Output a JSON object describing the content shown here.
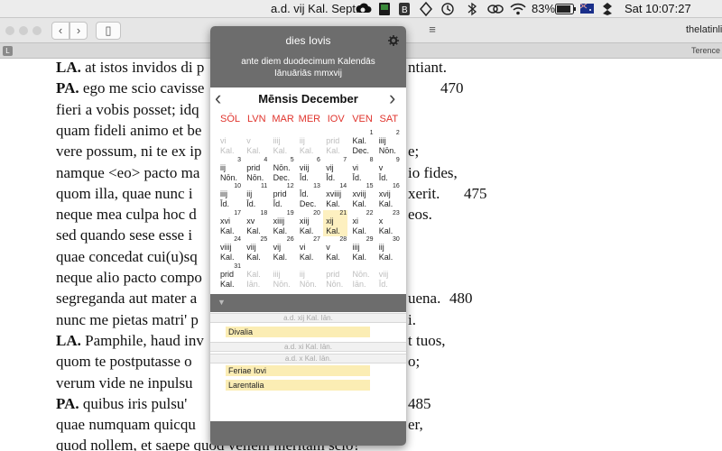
{
  "menubar": {
    "date": "a.d. vij Kal. Sept.",
    "battery": "83%",
    "time": "Sat 10:07:27",
    "icons": [
      "creative-cloud-icon",
      "display-icon",
      "backup-icon",
      "script-icon",
      "time-machine-icon",
      "bluetooth-icon",
      "link-icon",
      "wifi-icon",
      "flag-icon",
      "battery-icon",
      "dropbox-icon"
    ]
  },
  "toolbar": {
    "back": "‹",
    "forward": "›",
    "sidebar": "▯",
    "reader": "≡",
    "site": "thelatinli"
  },
  "tabbar": {
    "badge": "L",
    "right": "Terence"
  },
  "text": {
    "lines": [
      {
        "s": "LA.",
        "t": " at istos invidos di p",
        "e": "ntiant."
      },
      {
        "s": "PA.",
        "t": " ego me scio cavisse",
        "e": "",
        "no": "470"
      },
      {
        "s": "",
        "t": "fieri a vobis posset; idq",
        "e": ""
      },
      {
        "s": "",
        "t": "quam fideli animo et be",
        "e": ""
      },
      {
        "s": "",
        "t": "vere possum, ni te ex ip",
        "e": "e;"
      },
      {
        "s": "",
        "t": "namque <eo> pacto ma",
        "e": "io fides,"
      },
      {
        "s": "",
        "t": "quom illa, quae nunc i",
        "e": "xerit.",
        "no": "475"
      },
      {
        "s": "",
        "t": "neque mea culpa hoc d",
        "e": "eos."
      },
      {
        "s": "",
        "t": "sed quando sese esse i",
        "e": ""
      },
      {
        "s": "",
        "t": "quae concedat cui(u)sq",
        "e": ""
      },
      {
        "s": "",
        "t": "neque alio pacto compo",
        "e": ""
      },
      {
        "s": "",
        "t": "segreganda aut mater a",
        "e": "uena.",
        "no": "480"
      },
      {
        "s": "",
        "t": "nunc me pietas matri' p",
        "e": "i."
      },
      {
        "s": "LA.",
        "t": " Pamphile, haud inv",
        "e": "t tuos,"
      },
      {
        "s": "",
        "t": "quom te postputasse o",
        "e": "o;"
      },
      {
        "s": "",
        "t": "verum vide ne inpulsu",
        "e": ""
      },
      {
        "s": "PA.",
        "t": " quibus iris pulsu' ",
        "e": "",
        "no": "485"
      },
      {
        "s": "",
        "t": "quae numquam quicqu",
        "e": "er,"
      },
      {
        "s": "",
        "t": "quod nollem, et saepe quod vellem meritam scio?",
        "e": ""
      }
    ]
  },
  "popup": {
    "title": "dies Iovis",
    "subtitle1": "ante diem duodecimum Kalendās",
    "subtitle2": "Iānuāriās mmxvij",
    "month": "Mēnsis December",
    "prev": "‹",
    "next": "›",
    "dow": [
      "SŌL",
      "LVN",
      "MAR",
      "MER",
      "IOV",
      "VEN",
      "SAT"
    ],
    "weeks": [
      [
        {
          "a": "vi",
          "b": "Kal.",
          "n": "",
          "o": true
        },
        {
          "a": "v",
          "b": "Kal.",
          "n": "",
          "o": true
        },
        {
          "a": "iiij",
          "b": "Kal.",
          "n": "",
          "o": true
        },
        {
          "a": "iij",
          "b": "Kal.",
          "n": "",
          "o": true
        },
        {
          "a": "prid",
          "b": "Kal.",
          "n": "",
          "o": true
        },
        {
          "a": "Kal.",
          "b": "Dec.",
          "n": "1"
        },
        {
          "a": "iiij",
          "b": "Nōn.",
          "n": "2"
        }
      ],
      [
        {
          "a": "iij",
          "b": "Nōn.",
          "n": "3"
        },
        {
          "a": "prid",
          "b": "Nōn.",
          "n": "4"
        },
        {
          "a": "Nōn.",
          "b": "Dec.",
          "n": "5"
        },
        {
          "a": "viij",
          "b": "Īd.",
          "n": "6"
        },
        {
          "a": "vij",
          "b": "Īd.",
          "n": "7"
        },
        {
          "a": "vi",
          "b": "Īd.",
          "n": "8"
        },
        {
          "a": "v",
          "b": "Īd.",
          "n": "9"
        }
      ],
      [
        {
          "a": "iiij",
          "b": "Īd.",
          "n": "10"
        },
        {
          "a": "iij",
          "b": "Īd.",
          "n": "11"
        },
        {
          "a": "prid",
          "b": "Īd.",
          "n": "12"
        },
        {
          "a": "Īd.",
          "b": "Dec.",
          "n": "13"
        },
        {
          "a": "xviiij",
          "b": "Kal.",
          "n": "14"
        },
        {
          "a": "xviij",
          "b": "Kal.",
          "n": "15"
        },
        {
          "a": "xvij",
          "b": "Kal.",
          "n": "16"
        }
      ],
      [
        {
          "a": "xvi",
          "b": "Kal.",
          "n": "17"
        },
        {
          "a": "xv",
          "b": "Kal.",
          "n": "18"
        },
        {
          "a": "xiiij",
          "b": "Kal.",
          "n": "19"
        },
        {
          "a": "xiij",
          "b": "Kal.",
          "n": "20"
        },
        {
          "a": "xij",
          "b": "Kal.",
          "n": "21",
          "today": true
        },
        {
          "a": "xi",
          "b": "Kal.",
          "n": "22"
        },
        {
          "a": "x",
          "b": "Kal.",
          "n": "23"
        }
      ],
      [
        {
          "a": "viiij",
          "b": "Kal.",
          "n": "24"
        },
        {
          "a": "viij",
          "b": "Kal.",
          "n": "25"
        },
        {
          "a": "vij",
          "b": "Kal.",
          "n": "26"
        },
        {
          "a": "vi",
          "b": "Kal.",
          "n": "27"
        },
        {
          "a": "v",
          "b": "Kal.",
          "n": "28"
        },
        {
          "a": "iiij",
          "b": "Kal.",
          "n": "29"
        },
        {
          "a": "iij",
          "b": "Kal.",
          "n": "30"
        }
      ],
      [
        {
          "a": "prid",
          "b": "Kal.",
          "n": "31"
        },
        {
          "a": "Kal.",
          "b": "Iān.",
          "n": "",
          "o": true
        },
        {
          "a": "iiij",
          "b": "Nōn.",
          "n": "",
          "o": true
        },
        {
          "a": "iij",
          "b": "Nōn.",
          "n": "",
          "o": true
        },
        {
          "a": "prid",
          "b": "Nōn.",
          "n": "",
          "o": true
        },
        {
          "a": "Nōn.",
          "b": "Iān.",
          "n": "",
          "o": true
        },
        {
          "a": "viij",
          "b": "Īd.",
          "n": "",
          "o": true
        }
      ]
    ],
    "events": [
      {
        "day": "a.d. xij Kal. Iān.",
        "items": []
      },
      {
        "day": "",
        "items": [
          "Divalia"
        ]
      },
      {
        "day": "a.d. xi Kal. Iān.",
        "items": []
      },
      {
        "day": "a.d. x Kal. Iān.",
        "items": [
          "Feriae Iovi",
          "Larentalia"
        ]
      }
    ]
  },
  "colors": {
    "header": "#6d6d6d",
    "weekday": "#e0342d",
    "highlight": "#fdf0c0",
    "event": "#fbedb4"
  }
}
